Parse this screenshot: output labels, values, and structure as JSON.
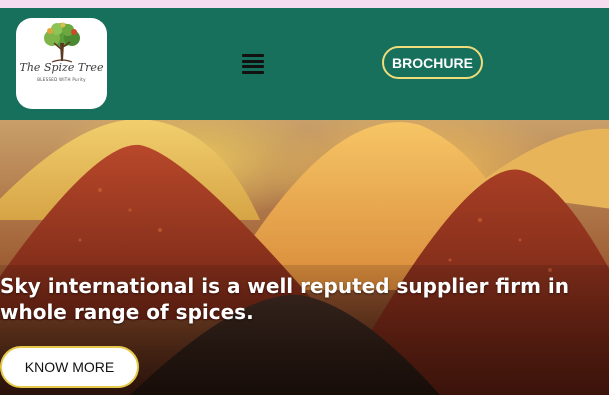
{
  "colors": {
    "top_strip": "#f6dcef",
    "header_bg": "#17705c",
    "button_border": "#f0dc7a",
    "cta_border": "#e6c84a"
  },
  "logo": {
    "name": "The Spize Tree",
    "tagline": "BLESSED WITH Purity",
    "icon": "tree-icon"
  },
  "header": {
    "menu_icon": "hamburger-menu-icon",
    "brochure_label": "BROCHURE"
  },
  "hero": {
    "heading": "Sky international is a well reputed supplier firm in whole range of spices.",
    "cta_label": "KNOW MORE"
  }
}
